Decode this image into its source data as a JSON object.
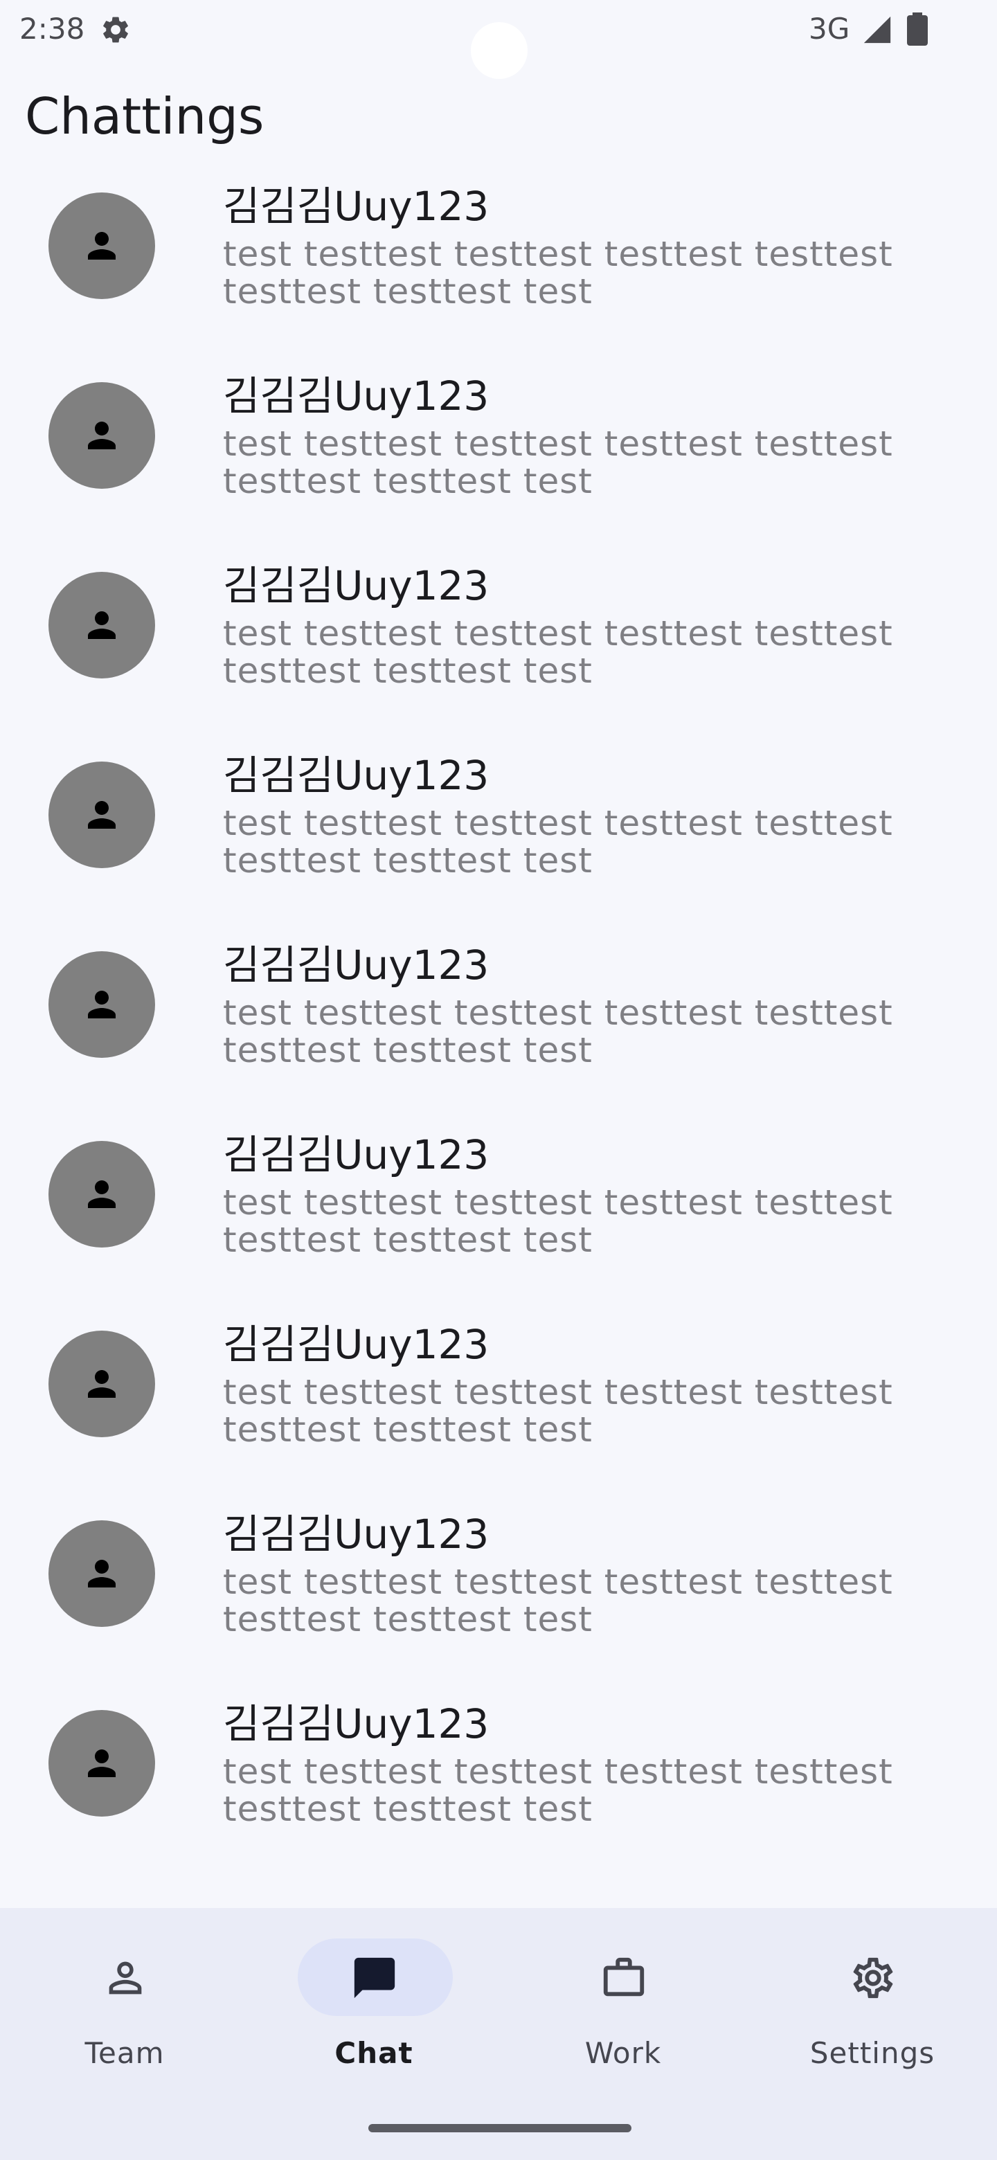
{
  "status_bar": {
    "time": "2:38",
    "network": "3G",
    "icons": [
      "gear-icon",
      "signal-icon",
      "battery-icon"
    ]
  },
  "header": {
    "title": "Chattings"
  },
  "chats": [
    {
      "name": "김김김Uuy123",
      "preview": "test testtest testtest testtest testtest testtest testtest test"
    },
    {
      "name": "김김김Uuy123",
      "preview": "test testtest testtest testtest testtest testtest testtest test"
    },
    {
      "name": "김김김Uuy123",
      "preview": "test testtest testtest testtest testtest testtest testtest test"
    },
    {
      "name": "김김김Uuy123",
      "preview": "test testtest testtest testtest testtest testtest testtest test"
    },
    {
      "name": "김김김Uuy123",
      "preview": "test testtest testtest testtest testtest testtest testtest test"
    },
    {
      "name": "김김김Uuy123",
      "preview": "test testtest testtest testtest testtest testtest testtest test"
    },
    {
      "name": "김김김Uuy123",
      "preview": "test testtest testtest testtest testtest testtest testtest test"
    },
    {
      "name": "김김김Uuy123",
      "preview": "test testtest testtest testtest testtest testtest testtest test"
    },
    {
      "name": "김김김Uuy123",
      "preview": "test testtest testtest testtest testtest testtest testtest test"
    }
  ],
  "bottom_nav": {
    "items": [
      {
        "label": "Team",
        "icon": "person-outline-icon",
        "active": false
      },
      {
        "label": "Chat",
        "icon": "chat-bubble-icon",
        "active": true
      },
      {
        "label": "Work",
        "icon": "briefcase-icon",
        "active": false
      },
      {
        "label": "Settings",
        "icon": "gear-icon",
        "active": false
      }
    ]
  },
  "colors": {
    "background": "#f6f7fc",
    "nav_background": "#eaecf7",
    "active_pill": "#dde2f8",
    "avatar": "#808080",
    "preview_text": "#7f7f84",
    "primary_text": "#1b1b1f"
  }
}
